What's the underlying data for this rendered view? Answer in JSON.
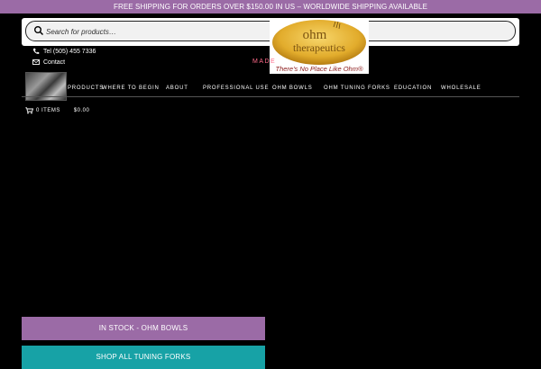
{
  "promo": {
    "text": "FREE SHIPPING FOR ORDERS OVER $150.00 IN US – WORLDWIDE SHIPPING AVAILABLE"
  },
  "search": {
    "placeholder": "Search for products…",
    "icon": "search-icon"
  },
  "logo": {
    "word": "ohm",
    "name": "therapeutics",
    "tagline": "There's No Place Like Ohm®"
  },
  "contact": {
    "phone": "Tel (505) 455 7336",
    "link": "Contact",
    "made": "MADE"
  },
  "nav": {
    "items": [
      "PRODUCTS",
      "WHERE TO BEGIN",
      "ABOUT",
      "PROFESSIONAL USE",
      "OHM BOWLS",
      "OHM TUNING FORKS",
      "EDUCATION",
      "WHOLESALE"
    ]
  },
  "cart": {
    "count": "0 ITEMS",
    "total": "$0.00",
    "icon": "cart-icon"
  },
  "buttons": {
    "bowls": "IN STOCK - OHM BOWLS",
    "forks": "SHOP ALL TUNING FORKS"
  },
  "colors": {
    "accent_purple": "#9b6ba6",
    "accent_teal": "#17a2a6",
    "logo_gold": "#e8b93a"
  }
}
